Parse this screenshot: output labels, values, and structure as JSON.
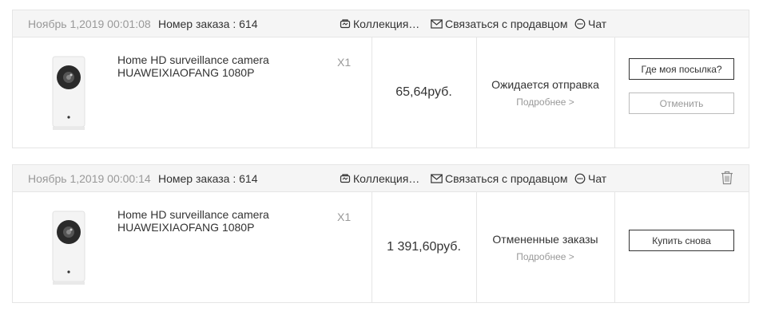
{
  "links": {
    "collection": "Коллекция…",
    "contact_seller": "Связаться с продавцом",
    "chat": "Чат"
  },
  "orders": [
    {
      "date": "Ноябрь 1,2019 00:01:08",
      "order_number": "Номер заказа : 614",
      "product_name": "Home HD surveillance camera HUAWEIXIAOFANG 1080P",
      "quantity": "X1",
      "price": "65,64руб.",
      "status": "Ожидается отправка",
      "details": "Подробнее >",
      "buttons": [
        "Где моя посылка?",
        "Отменить"
      ]
    },
    {
      "date": "Ноябрь 1,2019 00:00:14",
      "order_number": "Номер заказа : 614",
      "product_name": "Home HD surveillance camera HUAWEIXIAOFANG 1080P",
      "quantity": "X1",
      "price": "1 391,60руб.",
      "status": "Отмененные заказы",
      "details": "Подробнее >",
      "buttons": [
        "Купить снова"
      ]
    }
  ],
  "icons": [
    "collection-icon",
    "mail-icon",
    "chat-icon",
    "trash-icon"
  ]
}
